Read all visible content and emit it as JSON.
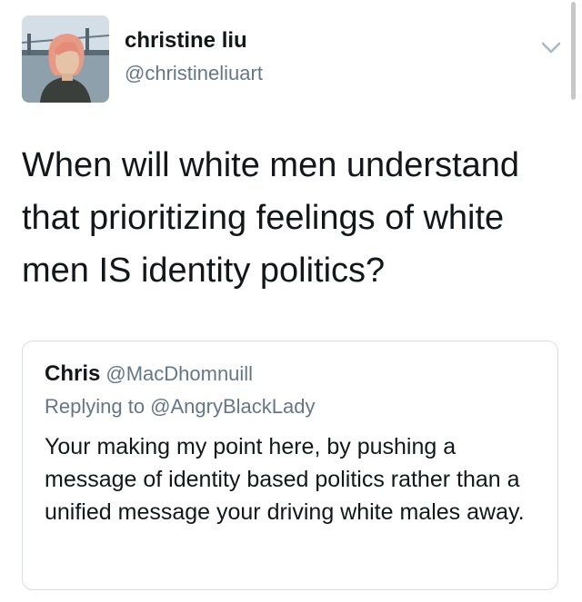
{
  "tweet": {
    "author_name": "christine liu",
    "author_handle": "@christineliuart",
    "text": "When will white men understand that prioritizing feelings of white men IS identity politics?",
    "menu_icon": "chevron-down-icon"
  },
  "quoted_tweet": {
    "author_name": "Chris",
    "author_handle": "@MacDhomnuill",
    "replying_to": "Replying to @AngryBlackLady",
    "text": "Your making my point here, by pushing a message of identity based politics rather than a unified message your driving white males away."
  },
  "colors": {
    "primary_text": "#14171a",
    "secondary_text": "#657786",
    "card_border": "#d8dde1"
  }
}
